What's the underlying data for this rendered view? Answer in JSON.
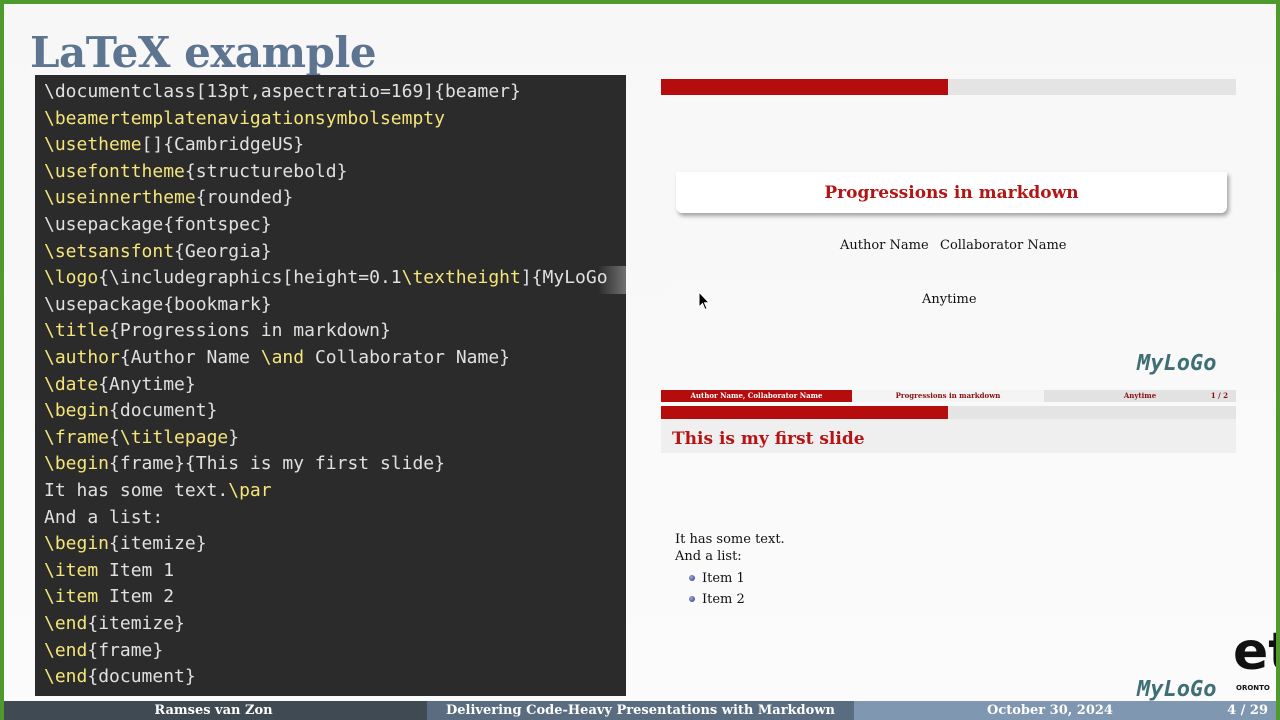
{
  "slide": {
    "title": "LaTeX example"
  },
  "code_lines": [
    [
      {
        "t": "\\documentclass[13pt,aspectratio=169]{beamer}",
        "k": false
      }
    ],
    [
      {
        "t": "\\beamertemplatenavigationsymbolsempty",
        "k": true
      }
    ],
    [
      {
        "t": "\\usetheme",
        "k": true
      },
      {
        "t": "[]{CambridgeUS}",
        "k": false
      }
    ],
    [
      {
        "t": "\\usefonttheme",
        "k": true
      },
      {
        "t": "{structurebold}",
        "k": false
      }
    ],
    [
      {
        "t": "\\useinnertheme",
        "k": true
      },
      {
        "t": "{rounded}",
        "k": false
      }
    ],
    [
      {
        "t": "\\usepackage{fontspec}",
        "k": false
      }
    ],
    [
      {
        "t": "\\setsansfont",
        "k": true
      },
      {
        "t": "{Georgia}",
        "k": false
      }
    ],
    [
      {
        "t": "\\logo",
        "k": true
      },
      {
        "t": "{\\includegraphics[height=0.1",
        "k": false
      },
      {
        "t": "\\textheight",
        "k": true
      },
      {
        "t": "]{MyLoGo",
        "k": false
      }
    ],
    [
      {
        "t": "\\usepackage{bookmark}",
        "k": false
      }
    ],
    [
      {
        "t": "\\title",
        "k": true
      },
      {
        "t": "{Progressions in markdown}",
        "k": false
      }
    ],
    [
      {
        "t": "\\author",
        "k": true
      },
      {
        "t": "{Author Name ",
        "k": false
      },
      {
        "t": "\\and",
        "k": true
      },
      {
        "t": " Collaborator Name}",
        "k": false
      }
    ],
    [
      {
        "t": "\\date",
        "k": true
      },
      {
        "t": "{Anytime}",
        "k": false
      }
    ],
    [
      {
        "t": "\\begin",
        "k": true
      },
      {
        "t": "{document}",
        "k": false
      }
    ],
    [
      {
        "t": "\\frame",
        "k": true
      },
      {
        "t": "{",
        "k": false
      },
      {
        "t": "\\titlepage",
        "k": true
      },
      {
        "t": "}",
        "k": false
      }
    ],
    [
      {
        "t": "\\begin",
        "k": true
      },
      {
        "t": "{frame}{This is my first slide}",
        "k": false
      }
    ],
    [
      {
        "t": "It has some text.",
        "k": false
      },
      {
        "t": "\\par",
        "k": true
      }
    ],
    [
      {
        "t": "And a list:",
        "k": false
      }
    ],
    [
      {
        "t": "\\begin",
        "k": true
      },
      {
        "t": "{itemize}",
        "k": false
      }
    ],
    [
      {
        "t": "\\item",
        "k": true
      },
      {
        "t": " Item 1",
        "k": false
      }
    ],
    [
      {
        "t": "\\item",
        "k": true
      },
      {
        "t": " Item 2",
        "k": false
      }
    ],
    [
      {
        "t": "\\end",
        "k": true
      },
      {
        "t": "{itemize}",
        "k": false
      }
    ],
    [
      {
        "t": "\\end",
        "k": true
      },
      {
        "t": "{frame}",
        "k": false
      }
    ],
    [
      {
        "t": "\\end",
        "k": true
      },
      {
        "t": "{document}",
        "k": false
      }
    ]
  ],
  "preview": {
    "title_page": {
      "title": "Progressions in markdown",
      "author": "Author Name",
      "collaborator": "Collaborator Name",
      "date": "Anytime",
      "logo": "MyLoGo"
    },
    "footline": {
      "authors": "Author Name, Collaborator Name",
      "title": "Progressions in markdown",
      "date": "Anytime",
      "page": "1 / 2"
    },
    "frame": {
      "title": "This is my first slide",
      "text_1": "It has some text.",
      "text_2": "And a list:",
      "items": [
        "Item 1",
        "Item 2"
      ],
      "logo": "MyLoGo"
    }
  },
  "bottom_bar": {
    "presenter": "Ramses van Zon",
    "talk_title": "Delivering Code-Heavy Presentations with Markdown",
    "date": "October 30, 2024",
    "page": "4 / 29"
  },
  "corner_logo": {
    "letters": "et",
    "subtext": "ORONTO"
  },
  "colors": {
    "frame_border": "#4e9a2e",
    "title": "#5d7591",
    "code_bg": "#2b2b2b",
    "code_keyword": "#f5e57a",
    "beamer_red": "#b50d0d",
    "logo": "#3e6e76",
    "bottom_bar_dark": "#3f4a52",
    "bottom_bar_mid": "#5a6d80",
    "bottom_bar_light": "#7f97b1"
  }
}
